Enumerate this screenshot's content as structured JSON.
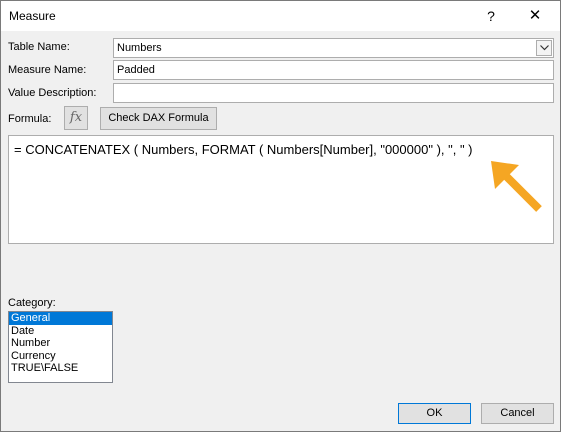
{
  "window": {
    "title": "Measure",
    "help": "?",
    "close": "✕"
  },
  "form": {
    "table_name_label": "Table Name:",
    "table_name_value": "Numbers",
    "measure_name_label": "Measure Name:",
    "measure_name_value": "Padded",
    "value_description_label": "Value Description:",
    "value_description_value": "",
    "formula_label": "Formula:",
    "fx_label": "fx",
    "check_dax_label": "Check DAX Formula",
    "formula_text": "= CONCATENATEX ( Numbers, FORMAT ( Numbers[Number], \"000000\" ), \", \" )",
    "category_label": "Category:"
  },
  "categories": {
    "items": [
      "General",
      "Date",
      "Number",
      "Currency",
      "TRUE\\FALSE"
    ],
    "selected": "General"
  },
  "buttons": {
    "ok": "OK",
    "cancel": "Cancel"
  },
  "colors": {
    "accent": "#0078d7",
    "annotation_arrow": "#f5a623"
  }
}
